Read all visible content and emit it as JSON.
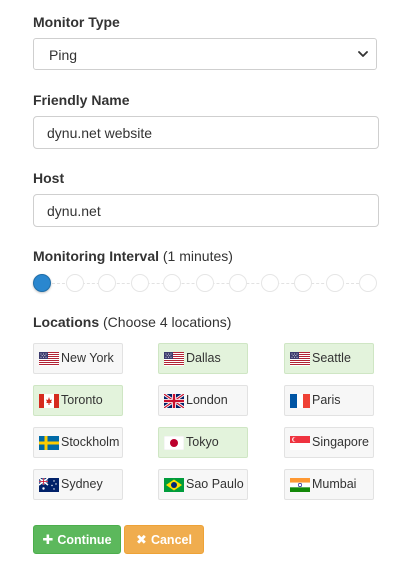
{
  "monitor_type": {
    "label": "Monitor Type",
    "value": "Ping"
  },
  "friendly_name": {
    "label": "Friendly Name",
    "value": "dynu.net website"
  },
  "host": {
    "label": "Host",
    "value": "dynu.net"
  },
  "interval": {
    "label": "Monitoring Interval",
    "note": "(1 minutes)",
    "selected_index": 0,
    "step_count": 11
  },
  "locations": {
    "label": "Locations",
    "note": "(Choose 4 locations)",
    "items": [
      {
        "name": "New York",
        "flag": "us-flag-icon",
        "selected": false
      },
      {
        "name": "Dallas",
        "flag": "us-flag-icon",
        "selected": true
      },
      {
        "name": "Seattle",
        "flag": "us-flag-icon",
        "selected": true
      },
      {
        "name": "Toronto",
        "flag": "canada-flag-icon",
        "selected": true
      },
      {
        "name": "London",
        "flag": "uk-flag-icon",
        "selected": false
      },
      {
        "name": "Paris",
        "flag": "france-flag-icon",
        "selected": false
      },
      {
        "name": "Stockholm",
        "flag": "sweden-flag-icon",
        "selected": false
      },
      {
        "name": "Tokyo",
        "flag": "japan-flag-icon",
        "selected": true
      },
      {
        "name": "Singapore",
        "flag": "singapore-flag-icon",
        "selected": false
      },
      {
        "name": "Sydney",
        "flag": "australia-flag-icon",
        "selected": false
      },
      {
        "name": "Sao Paulo",
        "flag": "brazil-flag-icon",
        "selected": false
      },
      {
        "name": "Mumbai",
        "flag": "india-flag-icon",
        "selected": false
      }
    ]
  },
  "buttons": {
    "continue": "Continue",
    "cancel": "Cancel"
  },
  "colors": {
    "selected_bg": "#e3f3dc",
    "unselected_bg": "#f7f7f7",
    "slider_active": "#2a87cf",
    "continue": "#5cb85c",
    "cancel": "#f0ad4e"
  }
}
